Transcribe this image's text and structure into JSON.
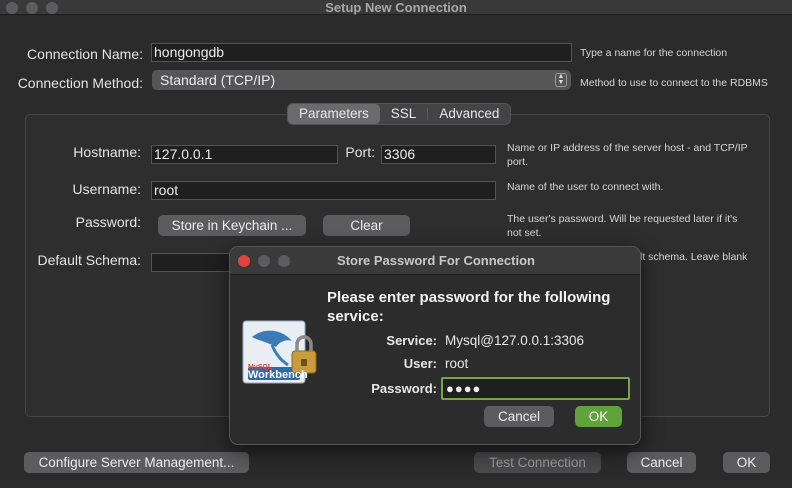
{
  "window": {
    "title": "Setup New Connection"
  },
  "form": {
    "connection_name_label": "Connection Name:",
    "connection_name_value": "hongongdb",
    "connection_name_hint": "Type a name for the connection",
    "connection_method_label": "Connection Method:",
    "connection_method_value": "Standard (TCP/IP)",
    "connection_method_hint": "Method to use to connect to the RDBMS"
  },
  "tabs": [
    {
      "label": "Parameters",
      "active": true
    },
    {
      "label": "SSL",
      "active": false
    },
    {
      "label": "Advanced",
      "active": false
    }
  ],
  "params": {
    "hostname_label": "Hostname:",
    "hostname_value": "127.0.0.1",
    "port_label": "Port:",
    "port_value": "3306",
    "hostname_hint_1": "Name or IP address of the server host - and TCP/IP",
    "hostname_hint_2": "port.",
    "username_label": "Username:",
    "username_value": "root",
    "username_hint": "Name of the user to connect with.",
    "password_label": "Password:",
    "store_keychain_label": "Store in Keychain ...",
    "clear_label": "Clear",
    "password_hint_1": "The user's password. Will be requested later if it's",
    "password_hint_2": "not set.",
    "schema_label": "Default Schema:",
    "schema_hint_partial": "lt schema. Leave blank"
  },
  "footer": {
    "configure_label": "Configure Server Management...",
    "test_label": "Test Connection",
    "cancel_label": "Cancel",
    "ok_label": "OK"
  },
  "modal": {
    "title": "Store Password For Connection",
    "heading_line1": "Please enter password for the following",
    "heading_line2": "service:",
    "service_label": "Service:",
    "service_value": "Mysql@127.0.0.1:3306",
    "user_label": "User:",
    "user_value": "root",
    "password_label": "Password:",
    "password_value": "●●●●",
    "logo_line1": "MySQL",
    "logo_line2": "Workbench",
    "cancel_label": "Cancel",
    "ok_label": "OK"
  },
  "colors": {
    "accent_green": "#5fa33a",
    "focus_ring": "#78a645",
    "background": "#2b2b2c"
  }
}
